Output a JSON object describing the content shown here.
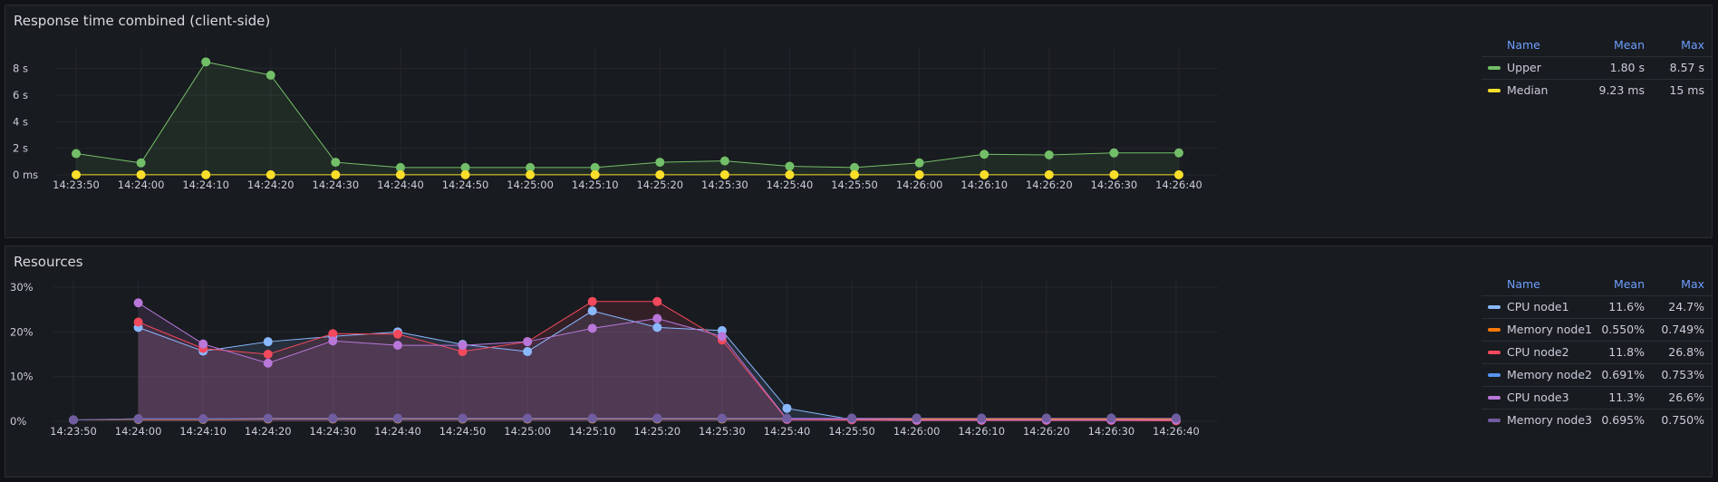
{
  "panels": {
    "response": {
      "title": "Response time combined (client-side)",
      "legend": {
        "headers": {
          "name": "Name",
          "mean": "Mean",
          "max": "Max"
        },
        "rows": [
          {
            "name": "Upper",
            "mean": "1.80 s",
            "max": "8.57 s",
            "color": "#73bf69"
          },
          {
            "name": "Median",
            "mean": "9.23 ms",
            "max": "15 ms",
            "color": "#fade2a"
          }
        ]
      }
    },
    "resources": {
      "title": "Resources",
      "legend": {
        "headers": {
          "name": "Name",
          "mean": "Mean",
          "max": "Max"
        },
        "rows": [
          {
            "name": "CPU node1",
            "mean": "11.6%",
            "max": "24.7%",
            "color": "#8ab8ff"
          },
          {
            "name": "Memory node1",
            "mean": "0.550%",
            "max": "0.749%",
            "color": "#ff780a"
          },
          {
            "name": "CPU node2",
            "mean": "11.8%",
            "max": "26.8%",
            "color": "#f2495c"
          },
          {
            "name": "Memory node2",
            "mean": "0.691%",
            "max": "0.753%",
            "color": "#5794f2"
          },
          {
            "name": "CPU node3",
            "mean": "11.3%",
            "max": "26.6%",
            "color": "#b877d9"
          },
          {
            "name": "Memory node3",
            "mean": "0.695%",
            "max": "0.750%",
            "color": "#705da0"
          }
        ]
      }
    }
  },
  "chart_data": [
    {
      "type": "line",
      "title": "Response time combined (client-side)",
      "categories": [
        "14:23:50",
        "14:24:00",
        "14:24:10",
        "14:24:20",
        "14:24:30",
        "14:24:40",
        "14:24:50",
        "14:25:00",
        "14:25:10",
        "14:25:20",
        "14:25:30",
        "14:25:40",
        "14:25:50",
        "14:26:00",
        "14:26:10",
        "14:26:20",
        "14:26:30",
        "14:26:40"
      ],
      "y_ticks": [
        "0 ms",
        "2 s",
        "4 s",
        "6 s",
        "8 s"
      ],
      "ylim": [
        0,
        9
      ],
      "y_unit": "s",
      "grid": true,
      "legend_placement": "right",
      "series": [
        {
          "name": "Upper",
          "color": "#73bf69",
          "fill": true,
          "values": [
            1.6,
            0.9,
            8.5,
            7.5,
            0.95,
            0.55,
            0.55,
            0.55,
            0.55,
            0.95,
            1.05,
            0.65,
            0.55,
            0.9,
            1.55,
            1.5,
            1.65,
            1.65
          ]
        },
        {
          "name": "Median",
          "color": "#fade2a",
          "fill": false,
          "values": [
            0.009,
            0.009,
            0.009,
            0.009,
            0.009,
            0.009,
            0.009,
            0.009,
            0.009,
            0.009,
            0.009,
            0.009,
            0.009,
            0.009,
            0.009,
            0.009,
            0.009,
            0.009
          ]
        }
      ]
    },
    {
      "type": "line",
      "title": "Resources",
      "categories": [
        "14:23:50",
        "14:24:00",
        "14:24:10",
        "14:24:20",
        "14:24:30",
        "14:24:40",
        "14:24:50",
        "14:25:00",
        "14:25:10",
        "14:25:20",
        "14:25:30",
        "14:25:40",
        "14:25:50",
        "14:26:00",
        "14:26:10",
        "14:26:20",
        "14:26:30",
        "14:26:40"
      ],
      "y_ticks": [
        "0%",
        "10%",
        "20%",
        "30%"
      ],
      "ylim": [
        0,
        30
      ],
      "y_unit": "%",
      "grid": true,
      "legend_placement": "right",
      "series": [
        {
          "name": "CPU node1",
          "color": "#8ab8ff",
          "fill": true,
          "values": [
            null,
            21,
            15.7,
            17.8,
            19,
            20,
            17.2,
            15.6,
            24.7,
            21,
            20.3,
            2.9,
            0.4,
            0.2,
            0.3,
            0.3,
            0.3,
            0.2
          ]
        },
        {
          "name": "Memory node1",
          "color": "#ff780a",
          "fill": false,
          "values": [
            0.3,
            0.4,
            0.4,
            0.5,
            0.5,
            0.5,
            0.5,
            0.5,
            0.5,
            0.5,
            0.5,
            0.5,
            0.5,
            0.5,
            0.5,
            0.5,
            0.5,
            0.5
          ]
        },
        {
          "name": "CPU node2",
          "color": "#f2495c",
          "fill": true,
          "values": [
            null,
            22.2,
            16.3,
            15,
            19.6,
            19.5,
            15.6,
            17.8,
            26.8,
            26.8,
            18.2,
            0.4,
            0.3,
            0.2,
            0.2,
            0.2,
            0.2,
            0.1
          ]
        },
        {
          "name": "Memory node2",
          "color": "#5794f2",
          "fill": false,
          "values": [
            0.3,
            0.5,
            0.5,
            0.6,
            0.6,
            0.6,
            0.6,
            0.6,
            0.6,
            0.6,
            0.6,
            0.6,
            0.7,
            0.7,
            0.7,
            0.7,
            0.7,
            0.7
          ]
        },
        {
          "name": "CPU node3",
          "color": "#b877d9",
          "fill": true,
          "values": [
            null,
            26.5,
            17.3,
            13,
            18,
            17,
            17,
            17.8,
            20.8,
            23,
            19,
            0.5,
            0.5,
            0.3,
            0.3,
            0.3,
            0.3,
            0.3
          ]
        },
        {
          "name": "Memory node3",
          "color": "#705da0",
          "fill": false,
          "values": [
            0.3,
            0.6,
            0.6,
            0.7,
            0.7,
            0.7,
            0.7,
            0.7,
            0.7,
            0.7,
            0.7,
            0.7,
            0.7,
            0.7,
            0.7,
            0.7,
            0.7,
            0.7
          ]
        }
      ]
    }
  ]
}
